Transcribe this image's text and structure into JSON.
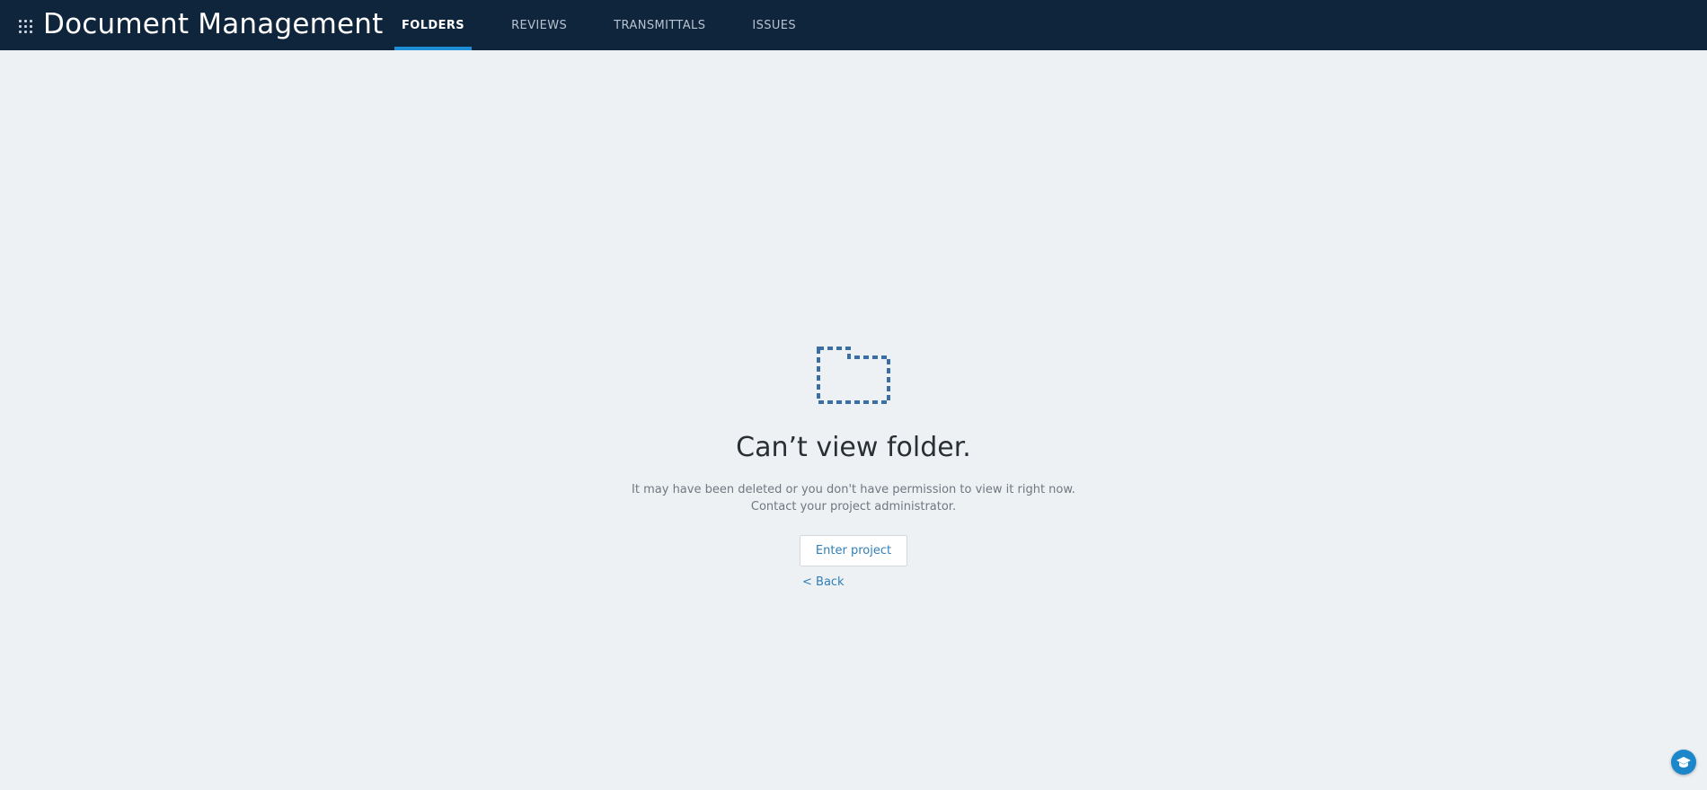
{
  "header": {
    "app_title": "Document Management",
    "tabs": [
      {
        "label": "FOLDERS",
        "active": true
      },
      {
        "label": "REVIEWS",
        "active": false
      },
      {
        "label": "TRANSMITTALS",
        "active": false
      },
      {
        "label": "ISSUES",
        "active": false
      }
    ]
  },
  "main": {
    "icon": "dashed-folder-icon",
    "headline": "Can’t view folder.",
    "message_line1": "It may have been deleted or you don't have permission to view it right now.",
    "message_line2": "Contact your project administrator.",
    "enter_button": "Enter project",
    "back_link": "< Back"
  },
  "help": {
    "icon": "learning-cap-icon"
  },
  "colors": {
    "topbar": "#0f253b",
    "accent": "#1e8fd6",
    "background": "#eef1f4",
    "link": "#2f7fb8",
    "folder_stroke": "#3a6fa5"
  }
}
